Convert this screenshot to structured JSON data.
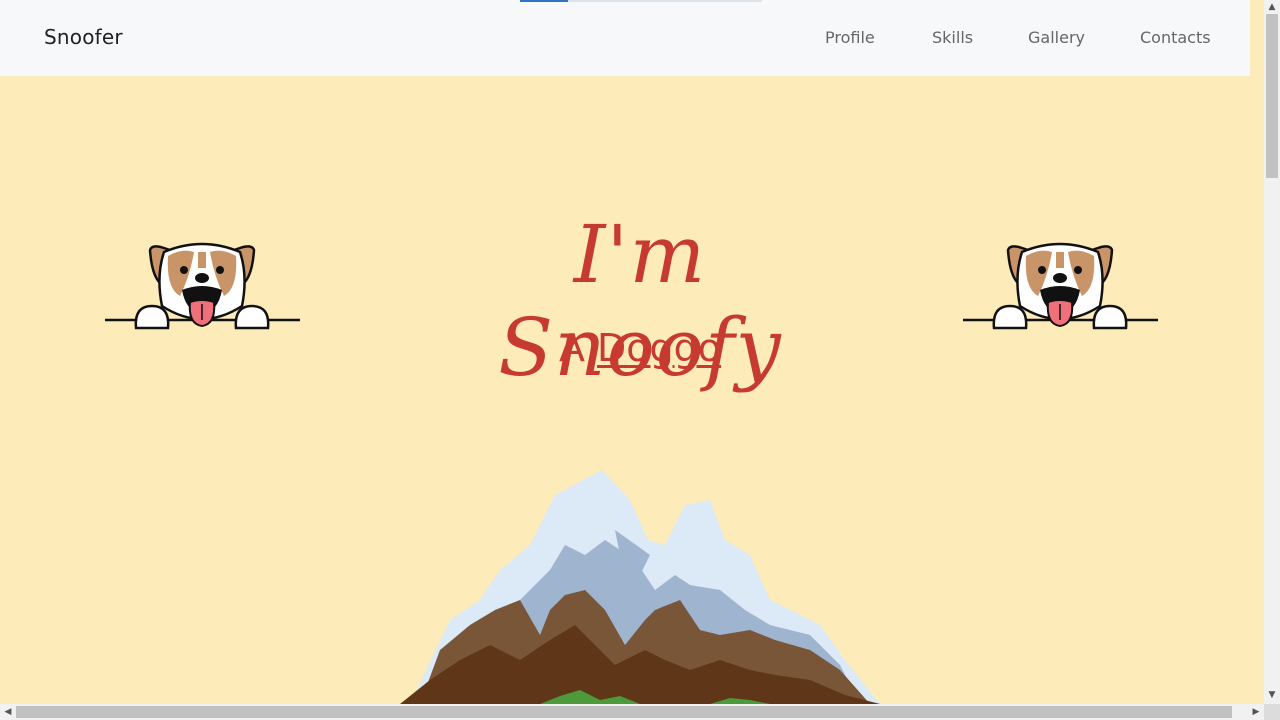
{
  "navbar": {
    "brand": "Snoofer",
    "links": [
      {
        "label": "Profile"
      },
      {
        "label": "Skills"
      },
      {
        "label": "Gallery"
      },
      {
        "label": "Contacts"
      }
    ],
    "scroll_progress_pct": 20
  },
  "hero": {
    "title": "I'm Snoofy",
    "subtitle_prefix": "A",
    "subtitle_word": "Doggo"
  },
  "colors": {
    "background": "#fdebb9",
    "accent": "#c63a32",
    "navbar_bg": "#f7f8f9",
    "progress": "#2f75c8"
  },
  "icons": {
    "left_dog": "dog-peeking-icon",
    "right_dog": "dog-peeking-icon",
    "scenery": "mountain-illustration"
  },
  "scrollbars": {
    "vertical": "scrollbar-vertical",
    "horizontal": "scrollbar-horizontal"
  }
}
